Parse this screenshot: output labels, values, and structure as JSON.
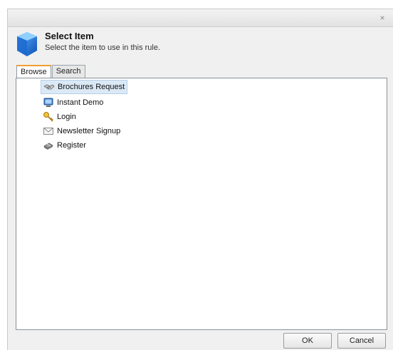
{
  "dialog": {
    "close_symbol": "×",
    "title": "Select Item",
    "subtitle": "Select the item to use in this rule."
  },
  "tabs": [
    {
      "label": "Browse",
      "active": true
    },
    {
      "label": "Search",
      "active": false
    }
  ],
  "tree": {
    "items": [
      {
        "label": "Brochures Request",
        "icon": "handshake-icon",
        "selected": true
      },
      {
        "label": "Instant Demo",
        "icon": "monitor-icon",
        "selected": false
      },
      {
        "label": "Login",
        "icon": "key-icon",
        "selected": false
      },
      {
        "label": "Newsletter Signup",
        "icon": "envelope-icon",
        "selected": false
      },
      {
        "label": "Register",
        "icon": "register-book-icon",
        "selected": false
      }
    ]
  },
  "buttons": {
    "ok_label": "OK",
    "cancel_label": "Cancel"
  },
  "colors": {
    "active_tab_accent": "#f0a030",
    "selection_bg": "#dbe9f6",
    "header_icon_blue": "#1a6fd6"
  }
}
